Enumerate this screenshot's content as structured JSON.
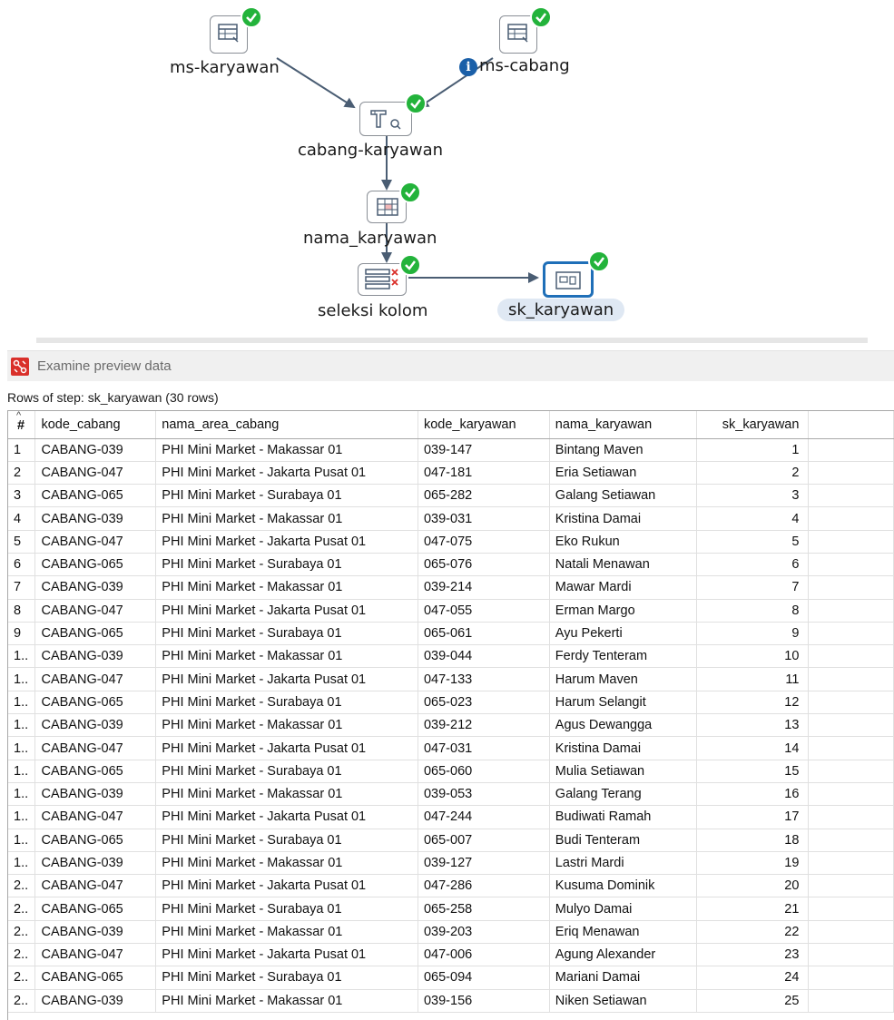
{
  "canvas": {
    "nodes": [
      {
        "label": "ms-karyawan"
      },
      {
        "label": "ms-cabang"
      },
      {
        "label": "cabang-karyawan"
      },
      {
        "label": "nama_karyawan"
      },
      {
        "label": "seleksi kolom"
      },
      {
        "label": "sk_karyawan"
      }
    ],
    "info_glyph": "i",
    "colors": {
      "accent": "#1f6fb8",
      "success": "#23b33b",
      "arrow": "#4a5d73"
    }
  },
  "toolbar": {
    "examine_label": "Examine preview data"
  },
  "preview": {
    "caption": "Rows of step: sk_karyawan (30 rows)",
    "sort_glyph": "^",
    "hash_header": "#",
    "columns": [
      "kode_cabang",
      "nama_area_cabang",
      "kode_karyawan",
      "nama_karyawan",
      "sk_karyawan"
    ],
    "rows": [
      [
        "1",
        "CABANG-039",
        "PHI Mini Market - Makassar 01",
        "039-147",
        "Bintang Maven",
        "1"
      ],
      [
        "2",
        "CABANG-047",
        "PHI Mini Market - Jakarta Pusat 01",
        "047-181",
        "Eria Setiawan",
        "2"
      ],
      [
        "3",
        "CABANG-065",
        "PHI Mini Market - Surabaya 01",
        "065-282",
        "Galang Setiawan",
        "3"
      ],
      [
        "4",
        "CABANG-039",
        "PHI Mini Market - Makassar 01",
        "039-031",
        "Kristina Damai",
        "4"
      ],
      [
        "5",
        "CABANG-047",
        "PHI Mini Market - Jakarta Pusat 01",
        "047-075",
        "Eko Rukun",
        "5"
      ],
      [
        "6",
        "CABANG-065",
        "PHI Mini Market - Surabaya 01",
        "065-076",
        "Natali Menawan",
        "6"
      ],
      [
        "7",
        "CABANG-039",
        "PHI Mini Market - Makassar 01",
        "039-214",
        "Mawar Mardi",
        "7"
      ],
      [
        "8",
        "CABANG-047",
        "PHI Mini Market - Jakarta Pusat 01",
        "047-055",
        "Erman Margo",
        "8"
      ],
      [
        "9",
        "CABANG-065",
        "PHI Mini Market - Surabaya 01",
        "065-061",
        "Ayu Pekerti",
        "9"
      ],
      [
        "1..",
        "CABANG-039",
        "PHI Mini Market - Makassar 01",
        "039-044",
        "Ferdy Tenteram",
        "10"
      ],
      [
        "1..",
        "CABANG-047",
        "PHI Mini Market - Jakarta Pusat 01",
        "047-133",
        "Harum Maven",
        "11"
      ],
      [
        "1..",
        "CABANG-065",
        "PHI Mini Market - Surabaya 01",
        "065-023",
        "Harum Selangit",
        "12"
      ],
      [
        "1..",
        "CABANG-039",
        "PHI Mini Market - Makassar 01",
        "039-212",
        "Agus Dewangga",
        "13"
      ],
      [
        "1..",
        "CABANG-047",
        "PHI Mini Market - Jakarta Pusat 01",
        "047-031",
        "Kristina Damai",
        "14"
      ],
      [
        "1..",
        "CABANG-065",
        "PHI Mini Market - Surabaya 01",
        "065-060",
        "Mulia Setiawan",
        "15"
      ],
      [
        "1..",
        "CABANG-039",
        "PHI Mini Market - Makassar 01",
        "039-053",
        "Galang Terang",
        "16"
      ],
      [
        "1..",
        "CABANG-047",
        "PHI Mini Market - Jakarta Pusat 01",
        "047-244",
        "Budiwati Ramah",
        "17"
      ],
      [
        "1..",
        "CABANG-065",
        "PHI Mini Market - Surabaya 01",
        "065-007",
        "Budi Tenteram",
        "18"
      ],
      [
        "1..",
        "CABANG-039",
        "PHI Mini Market - Makassar 01",
        "039-127",
        "Lastri Mardi",
        "19"
      ],
      [
        "2..",
        "CABANG-047",
        "PHI Mini Market - Jakarta Pusat 01",
        "047-286",
        "Kusuma Dominik",
        "20"
      ],
      [
        "2..",
        "CABANG-065",
        "PHI Mini Market - Surabaya 01",
        "065-258",
        "Mulyo Damai",
        "21"
      ],
      [
        "2..",
        "CABANG-039",
        "PHI Mini Market - Makassar 01",
        "039-203",
        "Eriq Menawan",
        "22"
      ],
      [
        "2..",
        "CABANG-047",
        "PHI Mini Market - Jakarta Pusat 01",
        "047-006",
        "Agung Alexander",
        "23"
      ],
      [
        "2..",
        "CABANG-065",
        "PHI Mini Market - Surabaya 01",
        "065-094",
        "Mariani Damai",
        "24"
      ],
      [
        "2..",
        "CABANG-039",
        "PHI Mini Market - Makassar 01",
        "039-156",
        "Niken Setiawan",
        "25"
      ]
    ]
  }
}
